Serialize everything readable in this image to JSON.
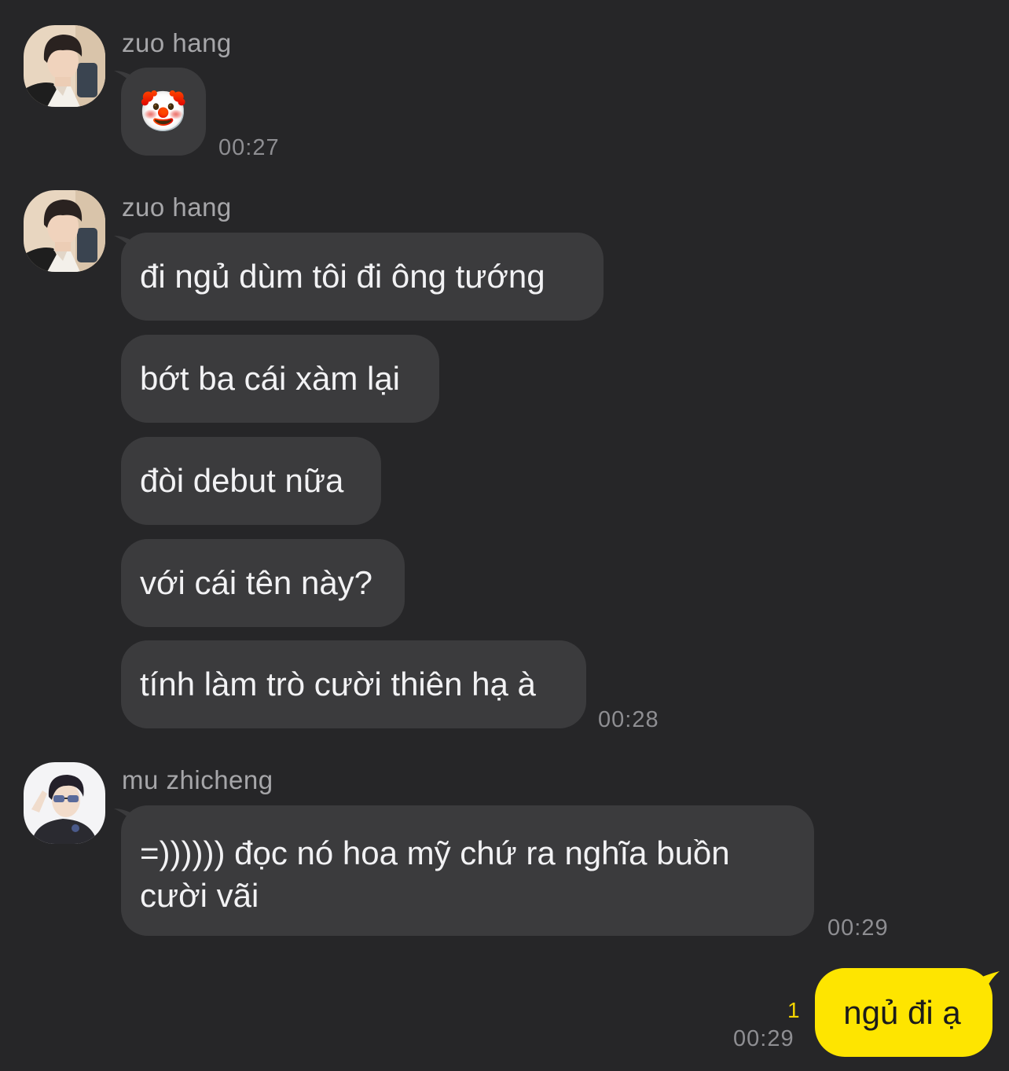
{
  "colors": {
    "background": "#262628",
    "bubble_other": "#3b3b3d",
    "bubble_mine": "#fee500",
    "sender_name": "#a6a6a9",
    "timestamp": "#8e8e92",
    "unread": "#f3d400"
  },
  "messages": [
    {
      "sender": "zuo hang",
      "avatar": "avatar-zuo-hang",
      "bubbles": [
        "🤡"
      ],
      "time": "00:27"
    },
    {
      "sender": "zuo hang",
      "avatar": "avatar-zuo-hang",
      "bubbles": [
        "đi ngủ dùm tôi đi ông tướng",
        "bớt ba cái xàm lại",
        "đòi debut nữa",
        "với cái tên này?",
        "tính làm trò cười thiên hạ à"
      ],
      "time": "00:28"
    },
    {
      "sender": "mu zhicheng",
      "avatar": "avatar-mu-zhicheng",
      "bubbles": [
        "=)))))) đọc nó hoa mỹ chứ ra nghĩa buồn cười vãi"
      ],
      "time": "00:29"
    }
  ],
  "my_message": {
    "text": "ngủ đi ạ",
    "unread_count": "1",
    "time": "00:29"
  }
}
